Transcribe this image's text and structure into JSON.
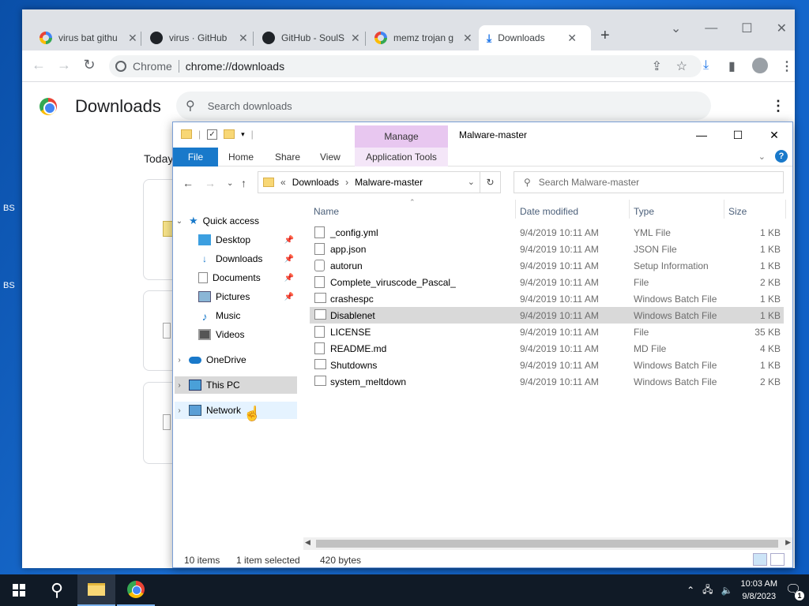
{
  "desktop": {
    "labels": [
      "BS",
      "BS"
    ]
  },
  "chrome": {
    "tabs": [
      {
        "title": "virus bat githu",
        "icon": "google-icon"
      },
      {
        "title": "virus · GitHub",
        "icon": "github-icon"
      },
      {
        "title": "GitHub - SoulS",
        "icon": "github-icon"
      },
      {
        "title": "memz trojan g",
        "icon": "google-icon"
      },
      {
        "title": "Downloads",
        "icon": "download-icon",
        "active": true
      }
    ],
    "new_tab": "+",
    "omnibox": {
      "site_label": "Chrome",
      "url": "chrome://downloads"
    },
    "downloads": {
      "title": "Downloads",
      "search_placeholder": "Search downloads",
      "section": "Today"
    }
  },
  "explorer": {
    "title": "Malware-master",
    "manage": "Manage",
    "ribbon_tabs": {
      "file": "File",
      "home": "Home",
      "share": "Share",
      "view": "View",
      "app_tools": "Application Tools"
    },
    "breadcrumb": {
      "prefix": "«",
      "items": [
        "Downloads",
        "Malware-master"
      ]
    },
    "search_placeholder": "Search Malware-master",
    "nav": {
      "quick_access": "Quick access",
      "desktop": "Desktop",
      "downloads": "Downloads",
      "documents": "Documents",
      "pictures": "Pictures",
      "music": "Music",
      "videos": "Videos",
      "onedrive": "OneDrive",
      "this_pc": "This PC",
      "network": "Network"
    },
    "columns": {
      "name": "Name",
      "date": "Date modified",
      "type": "Type",
      "size": "Size"
    },
    "files": [
      {
        "name": "_config.yml",
        "date": "9/4/2019 10:11 AM",
        "type": "YML File",
        "size": "1 KB"
      },
      {
        "name": "app.json",
        "date": "9/4/2019 10:11 AM",
        "type": "JSON File",
        "size": "1 KB"
      },
      {
        "name": "autorun",
        "date": "9/4/2019 10:11 AM",
        "type": "Setup Information",
        "size": "1 KB"
      },
      {
        "name": "Complete_viruscode_Pascal_",
        "date": "9/4/2019 10:11 AM",
        "type": "File",
        "size": "2 KB"
      },
      {
        "name": "crashespc",
        "date": "9/4/2019 10:11 AM",
        "type": "Windows Batch File",
        "size": "1 KB"
      },
      {
        "name": "Disablenet",
        "date": "9/4/2019 10:11 AM",
        "type": "Windows Batch File",
        "size": "1 KB",
        "selected": true
      },
      {
        "name": "LICENSE",
        "date": "9/4/2019 10:11 AM",
        "type": "File",
        "size": "35 KB"
      },
      {
        "name": "README.md",
        "date": "9/4/2019 10:11 AM",
        "type": "MD File",
        "size": "4 KB"
      },
      {
        "name": "Shutdowns",
        "date": "9/4/2019 10:11 AM",
        "type": "Windows Batch File",
        "size": "1 KB"
      },
      {
        "name": "system_meltdown",
        "date": "9/4/2019 10:11 AM",
        "type": "Windows Batch File",
        "size": "2 KB"
      }
    ],
    "status": {
      "items": "10 items",
      "selected": "1 item selected",
      "size": "420 bytes"
    }
  },
  "taskbar": {
    "time": "10:03 AM",
    "date": "9/8/2023",
    "notifications": "1"
  }
}
